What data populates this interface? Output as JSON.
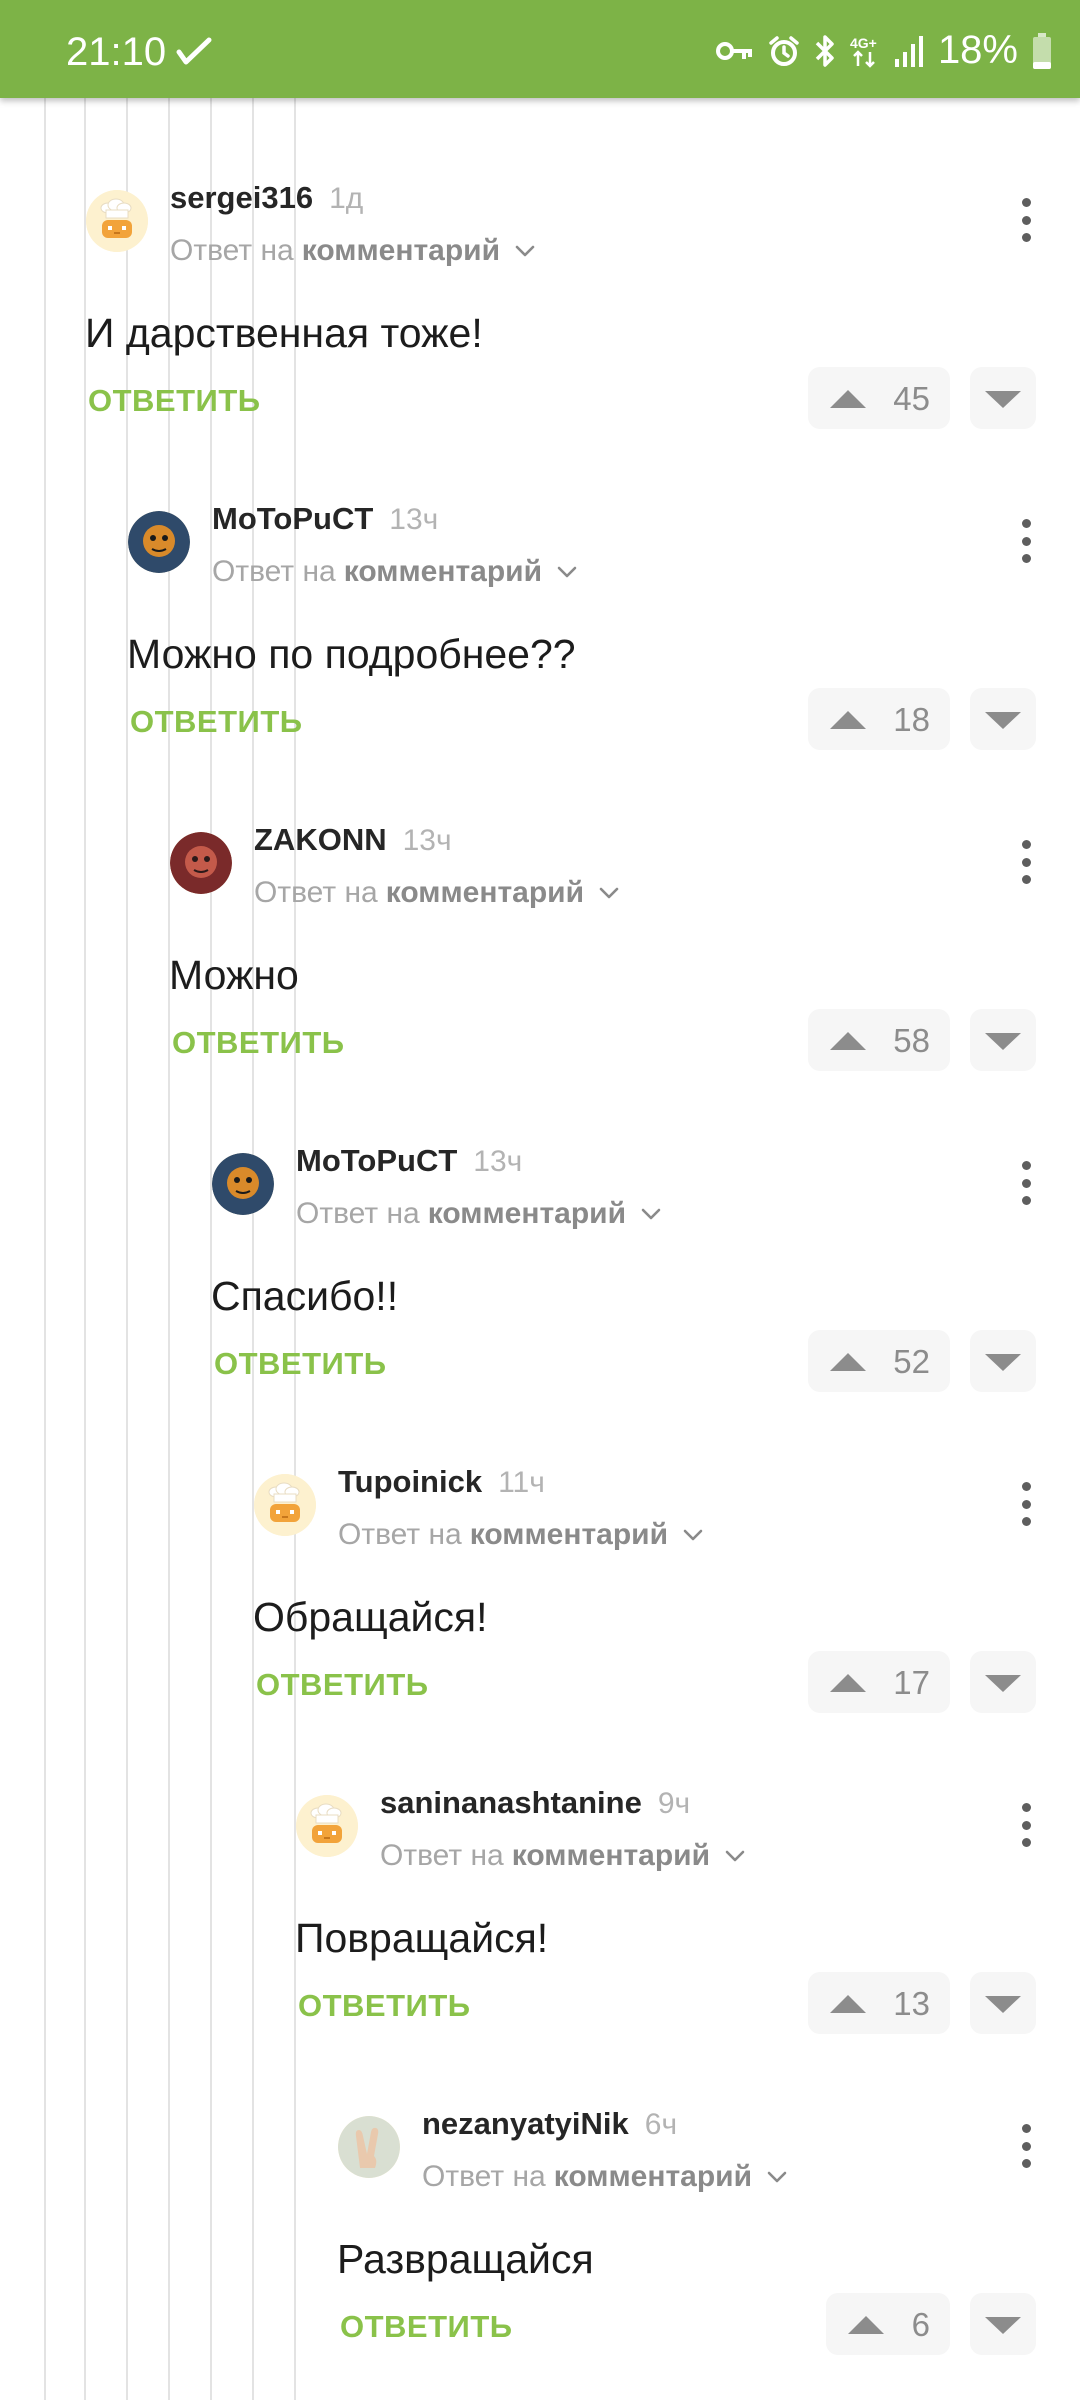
{
  "status_bar": {
    "time": "21:10",
    "battery": "18%",
    "icons": [
      "check-icon",
      "key-icon",
      "alarm-icon",
      "bluetooth-icon",
      "lte-icon",
      "signal-icon",
      "battery-icon"
    ]
  },
  "reply_prefix": "Ответ на",
  "reply_target": "комментарий",
  "reply_button": "ОТВЕТИТЬ",
  "colors": {
    "header": "#7db347",
    "accent": "#8ac24a",
    "text": "#1c1c1c",
    "muted": "#a6a6a6"
  },
  "comments": [
    {
      "author": "sergei316",
      "time": "1д",
      "text": "И дарственная тоже!",
      "rating": "45",
      "avatar": "default-cook-avatar"
    },
    {
      "author": "MoToPuCT",
      "time": "13ч",
      "text": "Можно по подробнее??",
      "rating": "18",
      "avatar": "user-photo-avatar"
    },
    {
      "author": "ZAKONN",
      "time": "13ч",
      "text": "Можно",
      "rating": "58",
      "avatar": "user-photo-avatar"
    },
    {
      "author": "MoToPuCT",
      "time": "13ч",
      "text": "Спасибо!!",
      "rating": "52",
      "avatar": "user-photo-avatar"
    },
    {
      "author": "Tupoinick",
      "time": "11ч",
      "text": "Обращайся!",
      "rating": "17",
      "avatar": "default-cook-avatar"
    },
    {
      "author": "saninanashtanine",
      "time": "9ч",
      "text": "Повращайся!",
      "rating": "13",
      "avatar": "default-cook-avatar"
    },
    {
      "author": "nezanyatyiNik",
      "time": "6ч",
      "text": "Развращайся",
      "rating": "6",
      "avatar": "hand-photo-avatar"
    }
  ]
}
